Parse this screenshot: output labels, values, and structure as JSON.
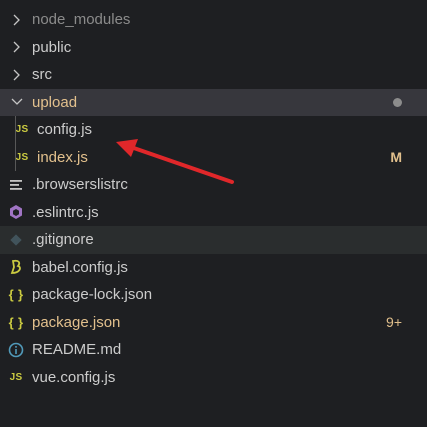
{
  "explorer": {
    "items": [
      {
        "label": "node_modules",
        "type": "folder",
        "state": "collapsed",
        "dim": true
      },
      {
        "label": "public",
        "type": "folder",
        "state": "collapsed"
      },
      {
        "label": "src",
        "type": "folder",
        "state": "collapsed"
      },
      {
        "label": "upload",
        "type": "folder",
        "state": "expanded",
        "modified": true,
        "indicator": "dot"
      },
      {
        "label": "config.js",
        "type": "file",
        "icon": "js-icon",
        "icon_text": "JS",
        "nested": true,
        "selected": true
      },
      {
        "label": "index.js",
        "type": "file",
        "icon": "js-icon",
        "icon_text": "JS",
        "nested": true,
        "modified": true,
        "badge": "M"
      },
      {
        "label": ".browserslistrc",
        "type": "file",
        "icon": "lines-icon"
      },
      {
        "label": ".eslintrc.js",
        "type": "file",
        "icon": "eslint-icon"
      },
      {
        "label": ".gitignore",
        "type": "file",
        "icon": "git-icon",
        "hovered": true
      },
      {
        "label": "babel.config.js",
        "type": "file",
        "icon": "babel-icon"
      },
      {
        "label": "package-lock.json",
        "type": "file",
        "icon": "braces-icon",
        "icon_text": "{ }"
      },
      {
        "label": "package.json",
        "type": "file",
        "icon": "braces-icon",
        "icon_text": "{ }",
        "modified": true,
        "badge": "9+"
      },
      {
        "label": "README.md",
        "type": "file",
        "icon": "info-icon"
      },
      {
        "label": "vue.config.js",
        "type": "file",
        "icon": "js-icon",
        "icon_text": "JS"
      }
    ]
  },
  "colors": {
    "background": "#1e1f22",
    "text": "#cccccc",
    "modified": "#e2c08d",
    "js_icon": "#cbcb41",
    "selection": "#37373d",
    "annotation_arrow": "#e0272a"
  },
  "annotation": {
    "type": "arrow",
    "points_to": "config.js"
  }
}
